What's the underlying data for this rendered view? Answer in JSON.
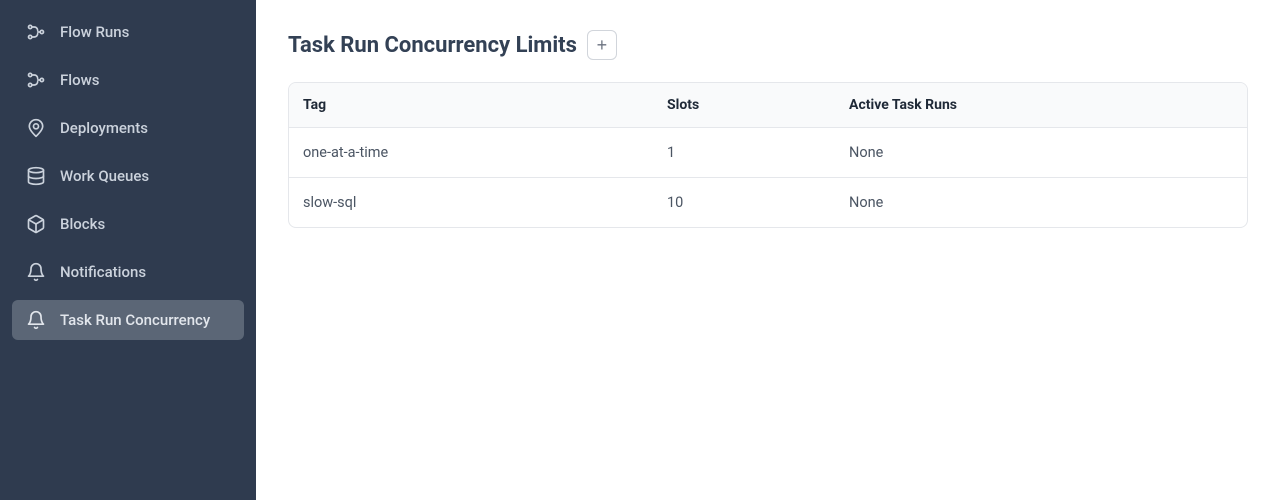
{
  "sidebar": {
    "items": [
      {
        "label": "Flow Runs",
        "icon": "flow-runs-icon",
        "active": false
      },
      {
        "label": "Flows",
        "icon": "flows-icon",
        "active": false
      },
      {
        "label": "Deployments",
        "icon": "deployments-icon",
        "active": false
      },
      {
        "label": "Work Queues",
        "icon": "work-queues-icon",
        "active": false
      },
      {
        "label": "Blocks",
        "icon": "blocks-icon",
        "active": false
      },
      {
        "label": "Notifications",
        "icon": "notifications-icon",
        "active": false
      },
      {
        "label": "Task Run Concurrency",
        "icon": "task-run-concurrency-icon",
        "active": true
      }
    ]
  },
  "main": {
    "title": "Task Run Concurrency Limits",
    "add_button_label": "+",
    "table": {
      "columns": [
        "Tag",
        "Slots",
        "Active Task Runs"
      ],
      "rows": [
        {
          "tag": "one-at-a-time",
          "slots": "1",
          "active": "None"
        },
        {
          "tag": "slow-sql",
          "slots": "10",
          "active": "None"
        }
      ]
    }
  }
}
